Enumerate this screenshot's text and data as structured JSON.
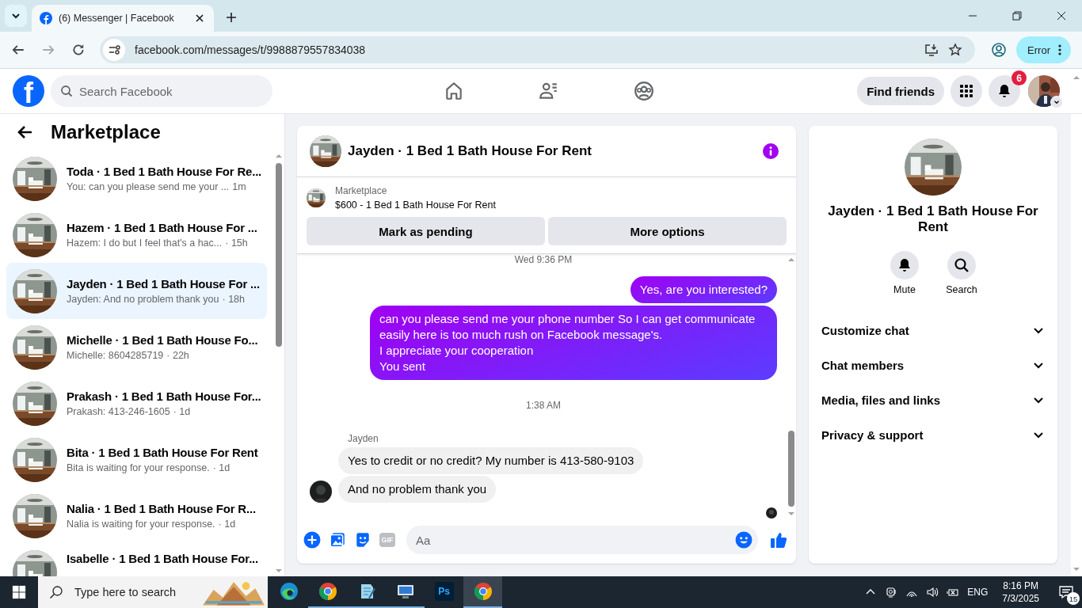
{
  "browser": {
    "tab": {
      "title": "(6) Messenger | Facebook"
    },
    "address": "facebook.com/messages/t/9988879557834038",
    "profile_button": "Error"
  },
  "header": {
    "logo_letter": "f",
    "search": {
      "placeholder": "Search Facebook"
    },
    "find_friends": "Find friends",
    "notification_count": "6"
  },
  "sidebar": {
    "title": "Marketplace",
    "conversations": [
      {
        "title": "Toda · 1 Bed 1 Bath House For Re...",
        "preview": "You: can you please send me your ...",
        "time": "1m",
        "selected": false
      },
      {
        "title": "Hazem · 1 Bed 1 Bath House For ...",
        "preview": "Hazem: I do but I feel that's a hac...",
        "time": "· 15h",
        "selected": false
      },
      {
        "title": "Jayden · 1 Bed 1 Bath House For ...",
        "preview": "Jayden: And no problem thank you",
        "time": "· 18h",
        "selected": true
      },
      {
        "title": "Michelle · 1 Bed 1 Bath House Fo...",
        "preview": "Michelle: 8604285719",
        "time": "· 22h",
        "selected": false
      },
      {
        "title": "Prakash · 1 Bed 1 Bath House For...",
        "preview": "Prakash: 413-246-1605",
        "time": "· 1d",
        "selected": false
      },
      {
        "title": "Bita · 1 Bed 1 Bath House For Rent",
        "preview": "Bita is waiting for your response.",
        "time": "· 1d",
        "selected": false
      },
      {
        "title": "Nalia · 1 Bed 1 Bath House For R...",
        "preview": "Nalia is waiting for your response.",
        "time": "· 1d",
        "selected": false
      },
      {
        "title": "Isabelle · 1 Bed 1 Bath House For...",
        "selected": false
      }
    ]
  },
  "chat": {
    "title": "Jayden · 1 Bed 1 Bath House For Rent",
    "listing": {
      "label": "Marketplace",
      "title": "$600 - 1 Bed 1 Bath House For Rent"
    },
    "actions": [
      "Mark as pending",
      "More options"
    ],
    "messages": [
      {
        "kind": "timestamp",
        "text": "Wed 9:36 PM"
      },
      {
        "kind": "sent",
        "text": "Yes, are you interested?"
      },
      {
        "kind": "sent",
        "text": "can you please send me your phone number So I can get communicate easily here is too much rush on Facebook message's.\nI appreciate your cooperation\nYou sent"
      },
      {
        "kind": "timestamp",
        "text": "1:38 AM"
      },
      {
        "kind": "sender",
        "text": "Jayden"
      },
      {
        "kind": "received",
        "text": "Yes to credit or no credit? My number is 413-580-9103",
        "avatar": false
      },
      {
        "kind": "received",
        "text": "And no problem thank you",
        "avatar": true
      }
    ],
    "composer": {
      "gif_label": "GIF",
      "placeholder": "Aa"
    }
  },
  "info": {
    "name": "Jayden · 1 Bed 1 Bath House For Rent",
    "actions": [
      {
        "kind": "mute",
        "label": "Mute"
      },
      {
        "kind": "search",
        "label": "Search"
      }
    ],
    "sections": [
      {
        "label": "Customize chat",
        "expanded": false
      },
      {
        "label": "Chat members",
        "expanded": false
      },
      {
        "label": "Media, files and links",
        "expanded": false
      },
      {
        "label": "Privacy & support",
        "expanded": false
      }
    ]
  },
  "taskbar": {
    "search": {
      "placeholder": "Type here to search"
    },
    "apps": [
      {
        "kind": "edge",
        "running": false,
        "selected": false
      },
      {
        "kind": "chrome",
        "running": true,
        "selected": false
      },
      {
        "kind": "notepad",
        "running": true,
        "selected": false
      },
      {
        "kind": "remote",
        "running": true,
        "selected": false
      },
      {
        "kind": "photoshop",
        "label": "Ps",
        "running": false,
        "selected": false
      },
      {
        "kind": "chrome",
        "running": true,
        "selected": true
      }
    ],
    "language": "ENG",
    "time": "8:16 PM",
    "date": "7/3/2025",
    "notification_count": "15"
  }
}
